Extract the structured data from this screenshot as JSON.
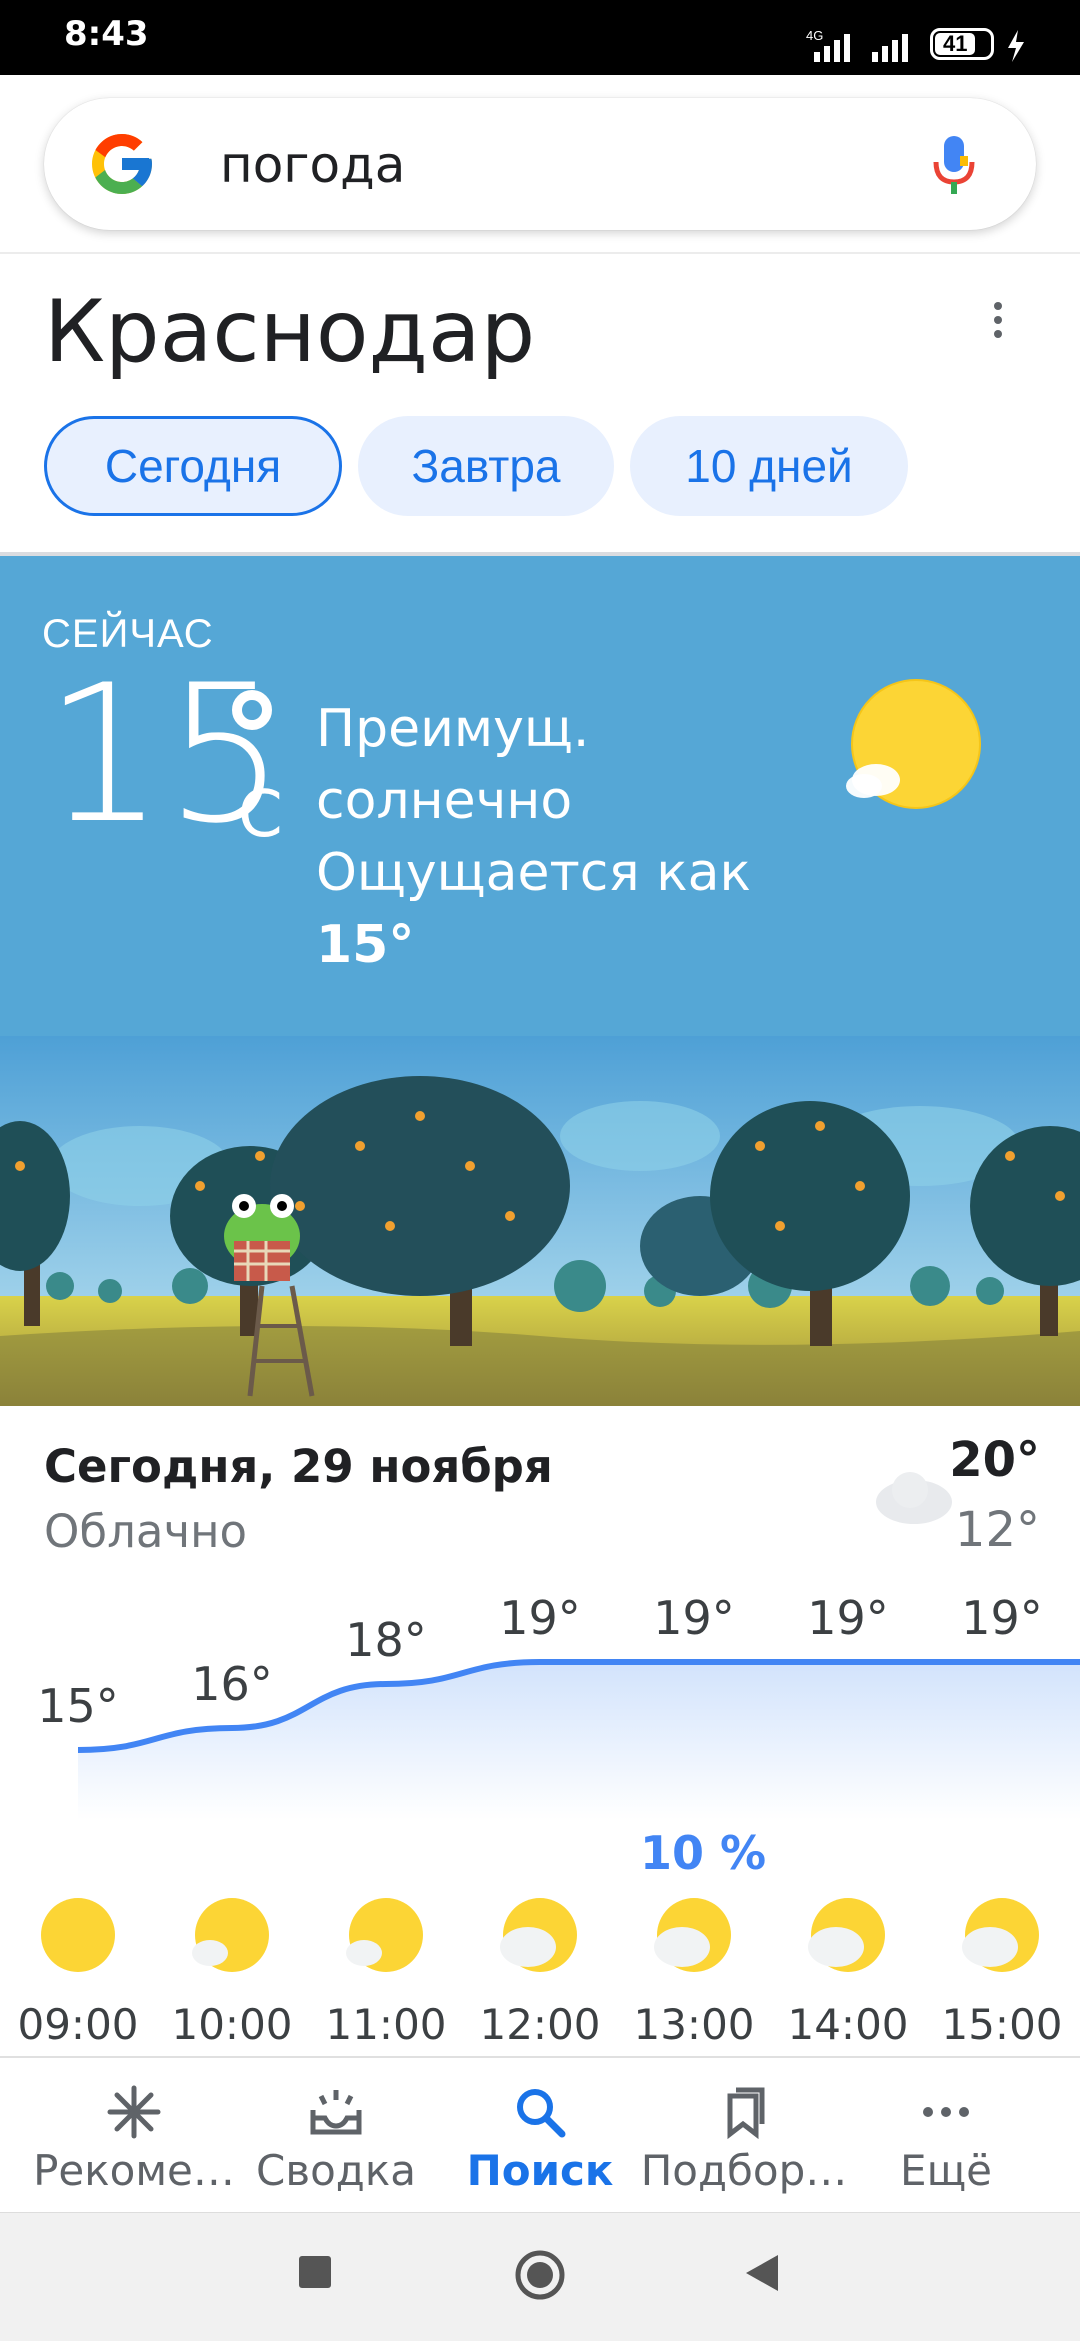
{
  "status_bar": {
    "time": "8:43",
    "network": "4G",
    "battery": "41"
  },
  "search": {
    "query": "погода"
  },
  "location": {
    "city": "Краснодар"
  },
  "tabs": [
    {
      "label": "Сегодня",
      "active": true
    },
    {
      "label": "Завтра",
      "active": false
    },
    {
      "label": "10 дней",
      "active": false
    }
  ],
  "now": {
    "label": "СЕЙЧАС",
    "temp": "15",
    "unit": "C",
    "condition_line1": "Преимущ.",
    "condition_line2": "солнечно",
    "feels_label": "Ощущается как",
    "feels_value": "15°"
  },
  "today": {
    "title": "Сегодня, 29 ноября",
    "condition": "Облачно",
    "high": "20°",
    "low": "12°"
  },
  "chart_data": {
    "type": "line",
    "x": [
      "09:00",
      "10:00",
      "11:00",
      "12:00",
      "13:00",
      "14:00",
      "15:00"
    ],
    "series": [
      {
        "values": [
          15,
          16,
          18,
          19,
          19,
          19,
          19
        ]
      }
    ],
    "tick_labels": [
      "15°",
      "16°",
      "18°",
      "19°",
      "19°",
      "19°",
      "19°"
    ],
    "annotations": [
      {
        "x": "13:00",
        "text": "10 %"
      }
    ],
    "icons": [
      "sunny",
      "mostly-sunny",
      "mostly-sunny",
      "partly-cloudy",
      "partly-cloudy",
      "partly-cloudy",
      "partly-cloudy"
    ]
  },
  "hourly": {
    "hours": [
      "09:00",
      "10:00",
      "11:00",
      "12:00",
      "13:00",
      "14:00",
      "15:00"
    ],
    "temps": [
      "15°",
      "16°",
      "18°",
      "19°",
      "19°",
      "19°",
      "19°"
    ],
    "precip_label": "10 %"
  },
  "bottom_nav": [
    {
      "label": "Рекоме…",
      "icon": "asterisk-icon"
    },
    {
      "label": "Сводка",
      "icon": "inbox-icon"
    },
    {
      "label": "Поиск",
      "icon": "search-icon",
      "active": true
    },
    {
      "label": "Подбор…",
      "icon": "collections-icon"
    },
    {
      "label": "Ещё",
      "icon": "more-icon"
    }
  ],
  "colors": {
    "accent": "#1a73e8",
    "sky": "#55a7d6",
    "sun": "#fcd535"
  }
}
